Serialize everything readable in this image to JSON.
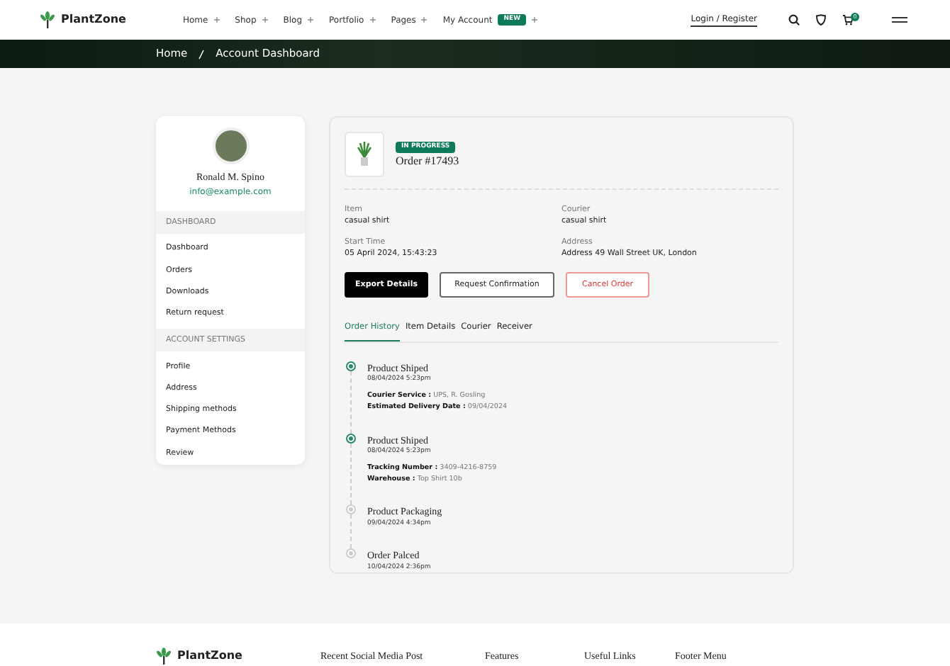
{
  "header": {
    "logo": "PlantZone",
    "nav": [
      {
        "label": "Home"
      },
      {
        "label": "Shop"
      },
      {
        "label": "Blog"
      },
      {
        "label": "Portfolio"
      },
      {
        "label": "Pages"
      },
      {
        "label": "My Account",
        "badge": "NEW"
      }
    ],
    "login": "Login / Register",
    "cart_count": "0"
  },
  "breadcrumb": [
    "Home",
    "Account Dashboard"
  ],
  "sidebar": {
    "name": "Ronald M. Spino",
    "email": "info@example.com",
    "sections": [
      {
        "title": "DASHBOARD",
        "items": [
          "Dashboard",
          "Orders",
          "Downloads",
          "Return request"
        ]
      },
      {
        "title": "ACCOUNT SETTINGS",
        "items": [
          "Profile",
          "Address",
          "Shipping methods",
          "Payment Methods",
          "Review"
        ]
      }
    ]
  },
  "order": {
    "status": "IN PROGRESS",
    "title": "Order #17493",
    "fields": [
      {
        "label": "Item",
        "value": "casual shirt"
      },
      {
        "label": "Courier",
        "value": "casual shirt"
      },
      {
        "label": "Start Time",
        "value": "05 April 2024, 15:43:23"
      },
      {
        "label": "Address",
        "value": "Address 49 Wall Street UK, London"
      }
    ],
    "buttons": [
      {
        "label": "Export Details",
        "kind": "primary"
      },
      {
        "label": "Request Confirmation",
        "kind": "outline"
      },
      {
        "label": "Cancel Order",
        "kind": "danger"
      }
    ],
    "tabs": [
      {
        "label": "Order History",
        "selected": true
      },
      {
        "label": "Item Details",
        "selected": false
      },
      {
        "label": "Courier",
        "selected": false
      },
      {
        "label": "Receiver",
        "selected": false
      }
    ],
    "timeline": [
      {
        "title": "Product Shiped",
        "time": "08/04/2024 5:23pm",
        "completed": true,
        "details": [
          {
            "label": "Courier Service :",
            "value": "UPS, R. Gosling"
          },
          {
            "label": "Estimated Delivery Date :",
            "value": "09/04/2024"
          }
        ]
      },
      {
        "title": "Product Shiped",
        "time": "08/04/2024 5:23pm",
        "completed": true,
        "details": [
          {
            "label": "Tracking Number :",
            "value": "3409-4216-8759"
          },
          {
            "label": "Warehouse :",
            "value": "Top Shirt 10b"
          }
        ]
      },
      {
        "title": "Product Packaging",
        "time": "09/04/2024 4:34pm",
        "completed": false
      },
      {
        "title": "Order Palced",
        "time": "10/04/2024 2:36pm",
        "completed": false
      }
    ]
  },
  "footer": {
    "logo": "PlantZone",
    "headings": [
      "Recent Social Media Post",
      "Features",
      "Useful Links",
      "Footer Menu"
    ]
  }
}
